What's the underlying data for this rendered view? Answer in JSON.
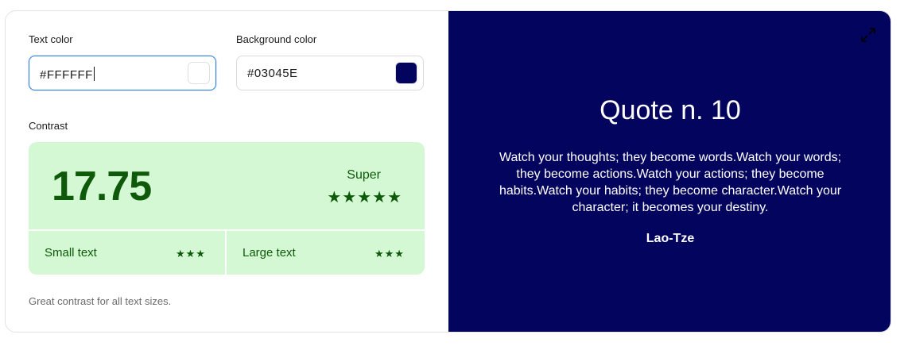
{
  "text_color": {
    "label": "Text color",
    "value": "#FFFFFF",
    "swatch_color": "#FFFFFF"
  },
  "background_color": {
    "label": "Background color",
    "value": "#03045E",
    "swatch_color": "#03045E"
  },
  "contrast": {
    "label": "Contrast",
    "ratio": "17.75",
    "rating": "Super",
    "overall_stars": "★★★★★",
    "small_text": {
      "label": "Small text",
      "stars": "★★★"
    },
    "large_text": {
      "label": "Large text",
      "stars": "★★★"
    },
    "summary": "Great contrast for all text sizes.",
    "panel_color": "#d4f8d3",
    "accent_color": "#0e5a0a"
  },
  "preview": {
    "title": "Quote n. 10",
    "body": "Watch your thoughts; they become words.Watch your words; they become actions.Watch your actions; they become habits.Watch your habits; they become character.Watch your character; it becomes your destiny.",
    "author": "Lao-Tze",
    "expand_icon": "expand-icon"
  }
}
